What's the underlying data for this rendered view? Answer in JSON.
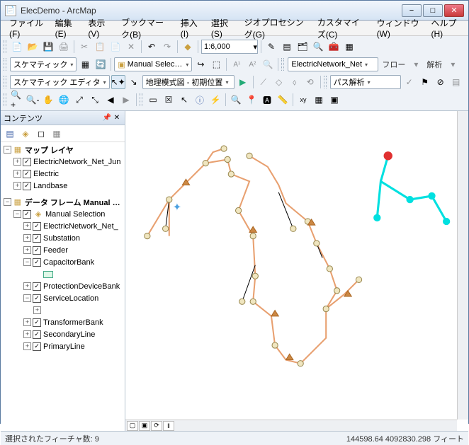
{
  "window": {
    "title": "ElecDemo - ArcMap",
    "min_tip": "−",
    "max_tip": "□",
    "close_tip": "✕"
  },
  "menu": {
    "file": "ファイル(F)",
    "edit": "編集(E)",
    "view": "表示(V)",
    "bookmark": "ブックマーク(B)",
    "insert": "挿入(I)",
    "select": "選択(S)",
    "geoprocessing": "ジオプロセシング(G)",
    "customize": "カスタマイズ(C)",
    "window": "ウィンドウ(W)",
    "help": "ヘルプ(H)"
  },
  "toolbar1": {
    "scale": "1:6,000"
  },
  "toolbar2": {
    "schematic_label": "スケマティック",
    "manual_selection": "Manual Selection",
    "network_combo": "ElectricNetwork_Net",
    "flow_label": "フロー",
    "analysis_label": "解析"
  },
  "toolbar3": {
    "schematic_editor": "スケマティック エディタ",
    "geo_initial": "地理模式図 - 初期位置",
    "path_analysis": "パス解析"
  },
  "toc": {
    "title": "コンテンツ",
    "tree": {
      "df1_label": "マップ レイヤ",
      "df1_items": [
        {
          "label": "ElectricNetwork_Net_Jun",
          "checked": true,
          "exp": "+"
        },
        {
          "label": "Electric",
          "checked": true,
          "exp": "+"
        },
        {
          "label": "Landbase",
          "checked": true,
          "exp": "+"
        }
      ],
      "df2_label": "データ フレーム Manual Sel",
      "df2_ms": "Manual Selection",
      "df2_items": [
        {
          "label": "ElectricNetwork_Net_",
          "checked": true,
          "exp": "+"
        },
        {
          "label": "Substation",
          "checked": true,
          "exp": "+"
        },
        {
          "label": "Feeder",
          "checked": true,
          "exp": "+"
        },
        {
          "label": "CapacitorBank",
          "checked": true,
          "exp": "−",
          "symbol": true
        },
        {
          "label": "ProtectionDeviceBank",
          "checked": true,
          "exp": "+"
        },
        {
          "label": "ServiceLocation",
          "checked": true,
          "exp": "−",
          "subexp": true
        },
        {
          "label": "TransformerBank",
          "checked": true,
          "exp": "+"
        },
        {
          "label": "SecondaryLine",
          "checked": true,
          "exp": "+"
        },
        {
          "label": "PrimaryLine",
          "checked": true,
          "exp": "+"
        }
      ]
    }
  },
  "status": {
    "selected": "選択されたフィーチャ数: 9",
    "coords": "144598.64 4092830.298 フィート"
  }
}
